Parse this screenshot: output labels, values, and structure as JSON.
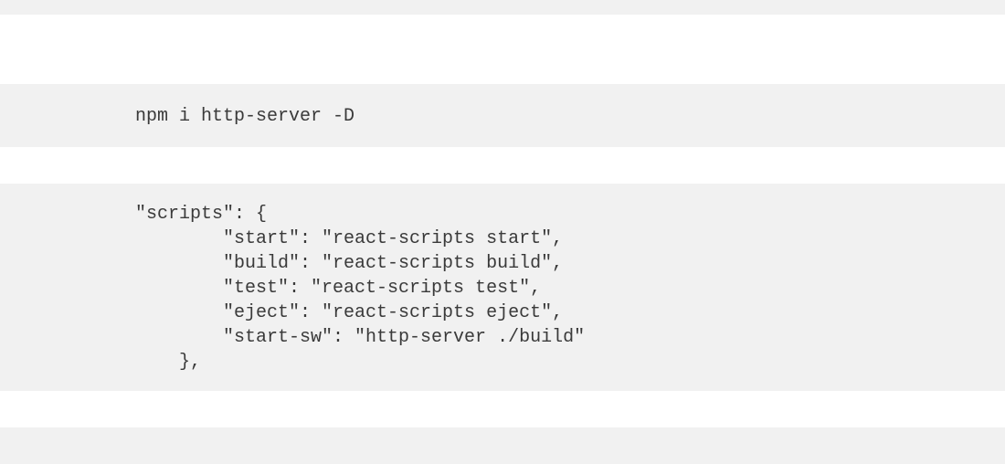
{
  "command": "npm i http-server -D",
  "scripts_block": "\"scripts\": {\n        \"start\": \"react-scripts start\",\n        \"build\": \"react-scripts build\",\n        \"test\": \"react-scripts test\",\n        \"eject\": \"react-scripts eject\",\n        \"start-sw\": \"http-server ./build\"\n    },"
}
